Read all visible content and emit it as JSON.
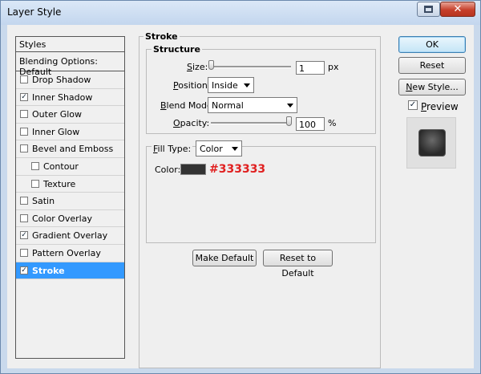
{
  "window": {
    "title": "Layer Style"
  },
  "sidebar": {
    "header": "Styles",
    "blending_options": "Blending Options: Default",
    "items": [
      {
        "label": "Drop Shadow",
        "checked": false,
        "indent": 0
      },
      {
        "label": "Inner Shadow",
        "checked": true,
        "indent": 0
      },
      {
        "label": "Outer Glow",
        "checked": false,
        "indent": 0
      },
      {
        "label": "Inner Glow",
        "checked": false,
        "indent": 0
      },
      {
        "label": "Bevel and Emboss",
        "checked": false,
        "indent": 0
      },
      {
        "label": "Contour",
        "checked": false,
        "indent": 1
      },
      {
        "label": "Texture",
        "checked": false,
        "indent": 1
      },
      {
        "label": "Satin",
        "checked": false,
        "indent": 0
      },
      {
        "label": "Color Overlay",
        "checked": false,
        "indent": 0
      },
      {
        "label": "Gradient Overlay",
        "checked": true,
        "indent": 0
      },
      {
        "label": "Pattern Overlay",
        "checked": false,
        "indent": 0
      },
      {
        "label": "Stroke",
        "checked": true,
        "indent": 0,
        "selected": true
      }
    ]
  },
  "stroke": {
    "group_title": "Stroke",
    "structure_title": "Structure",
    "size": {
      "label": "Size:",
      "value": "1",
      "unit": "px",
      "slider_fraction": 0.0
    },
    "position": {
      "label": "Position:",
      "value": "Inside"
    },
    "blend_mode": {
      "label": "Blend Mode:",
      "value": "Normal"
    },
    "opacity": {
      "label": "Opacity:",
      "value": "100",
      "unit": "%",
      "slider_fraction": 1.0
    },
    "fill_type": {
      "label": "Fill Type:",
      "value": "Color"
    },
    "color": {
      "label": "Color:",
      "swatch": "#333333",
      "annotation": "#333333"
    },
    "make_default": "Make Default",
    "reset_to_default": "Reset to Default"
  },
  "actions": {
    "ok": "OK",
    "reset": "Reset",
    "new_style": "New Style...",
    "preview_label": "Preview",
    "preview_checked": true
  },
  "titlebar_buttons": {
    "close": "✕"
  }
}
